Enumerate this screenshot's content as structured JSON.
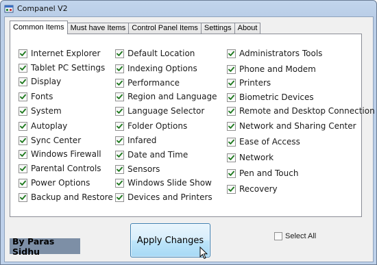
{
  "window": {
    "title": "Companel V2",
    "icon": "app-window-icon"
  },
  "tabs": [
    {
      "label": "Common Items",
      "active": true
    },
    {
      "label": "Must have Items",
      "active": false
    },
    {
      "label": "Control Panel Items",
      "active": false
    },
    {
      "label": "Settings",
      "active": false
    },
    {
      "label": "About",
      "active": false
    }
  ],
  "columns": [
    [
      {
        "label": "Internet Explorer",
        "checked": true
      },
      {
        "label": "Tablet PC Settings",
        "checked": true
      },
      {
        "label": "Display",
        "checked": true
      },
      {
        "label": "Fonts",
        "checked": true
      },
      {
        "label": "System",
        "checked": true
      },
      {
        "label": "Autoplay",
        "checked": true
      },
      {
        "label": "Sync Center",
        "checked": true
      },
      {
        "label": "Windows Firewall",
        "checked": true
      },
      {
        "label": "Parental Controls",
        "checked": true
      },
      {
        "label": "Power Options",
        "checked": true
      },
      {
        "label": "Backup and Restore",
        "checked": true
      }
    ],
    [
      {
        "label": "Default Location",
        "checked": true
      },
      {
        "label": "Indexing Options",
        "checked": true
      },
      {
        "label": "Performance",
        "checked": true
      },
      {
        "label": "Region and Language",
        "checked": true
      },
      {
        "label": "Language Selector",
        "checked": true
      },
      {
        "label": "Folder Options",
        "checked": true
      },
      {
        "label": "Infared",
        "checked": true
      },
      {
        "label": "Date and Time",
        "checked": true
      },
      {
        "label": "Sensors",
        "checked": true
      },
      {
        "label": "Windows Slide Show",
        "checked": true
      },
      {
        "label": "Devices and Printers",
        "checked": true
      }
    ],
    [
      {
        "label": "Administrators Tools",
        "checked": true
      },
      {
        "label": "Phone and Modem",
        "checked": true
      },
      {
        "label": "Printers",
        "checked": true
      },
      {
        "label": "Biometric Devices",
        "checked": true
      },
      {
        "label": "Remote and Desktop Connection",
        "checked": true
      },
      {
        "label": "Network and Sharing Center",
        "checked": true
      },
      {
        "label": "Ease of Access",
        "checked": true
      },
      {
        "label": "Network",
        "checked": true
      },
      {
        "label": "Pen and Touch",
        "checked": true
      },
      {
        "label": "Recovery",
        "checked": true
      }
    ]
  ],
  "footer": {
    "credit": "By Paras Sidhu",
    "apply_label": "Apply Changes",
    "select_all_label": "Select All",
    "select_all_checked": false
  },
  "colors": {
    "title_bar": "#b9cde7",
    "credit_bg": "#7d8fa6",
    "button_blue": "#a7d9f5",
    "check_green": "#1f7a1f"
  }
}
